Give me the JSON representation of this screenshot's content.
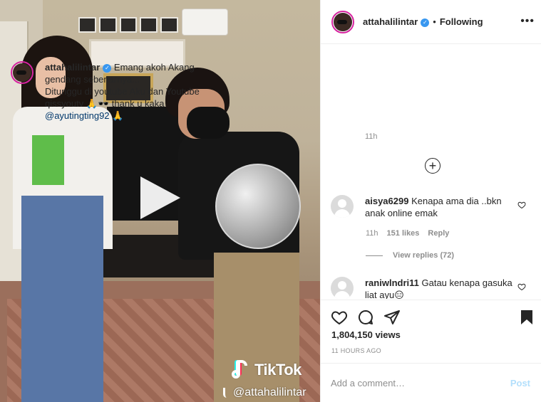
{
  "video": {
    "tiktok_word": "TikTok",
    "tiktok_handle": "@attahalilintar"
  },
  "header": {
    "username": "attahalilintar",
    "separator": "•",
    "follow_label": "Following",
    "more_icon": "more-horizontal-icon"
  },
  "caption": {
    "username": "attahalilintar",
    "line1": "Emang akoh Akang gendang sebenarnya...",
    "line2": "Ditunggu di youtube Aku dan Youtube qissyoutv 🙏🕶️ thank u kaka",
    "mention": "@ayutingting92",
    "mention_suffix": " 🙏",
    "time": "11h"
  },
  "comments": [
    {
      "username": "aisya6299",
      "text": "Kenapa ama dia ..bkn anak online emak",
      "time": "11h",
      "likes": "151 likes",
      "reply_label": "Reply",
      "view_replies": "View replies (72)"
    },
    {
      "username": "raniwlndri11",
      "text": "Gatau kenapa gasuka liat ayu😑"
    }
  ],
  "actions": {
    "views": "1,804,150 views",
    "time_ago": "11 HOURS AGO"
  },
  "comment_box": {
    "placeholder": "Add a comment…",
    "post_label": "Post"
  },
  "colors": {
    "verified": "#3897f0",
    "post_button_disabled": "#b2dffc",
    "meta_gray": "#8e8e8e",
    "text": "#262626"
  }
}
